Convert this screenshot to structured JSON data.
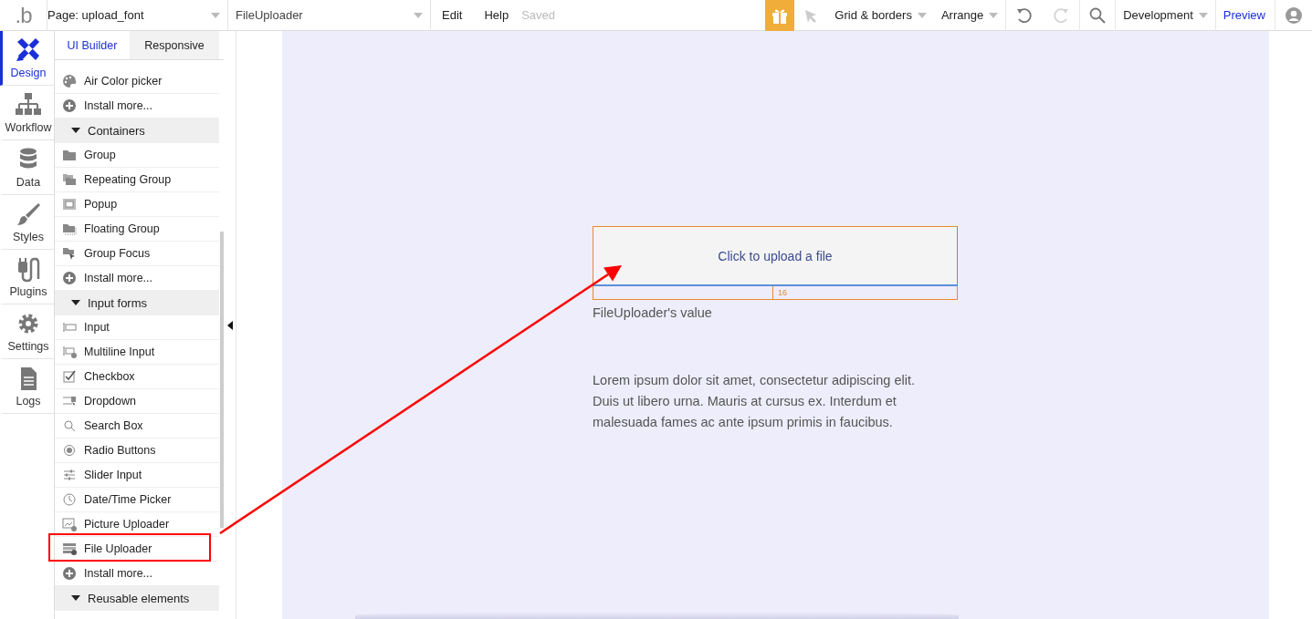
{
  "topbar": {
    "logo": ".b",
    "page_selector": "Page: upload_font",
    "element_selector": "FileUploader",
    "menu": [
      "Edit",
      "Help"
    ],
    "save_status": "Saved",
    "tools": [
      {
        "kind": "gift"
      },
      {
        "kind": "pointer",
        "disabled": true
      },
      {
        "kind": "dropdown",
        "label": "Grid & borders"
      },
      {
        "kind": "dropdown",
        "label": "Arrange"
      },
      {
        "kind": "undo",
        "disabled": false
      },
      {
        "kind": "redo",
        "disabled": true
      },
      {
        "kind": "search"
      },
      {
        "kind": "dropdown",
        "label": "Development"
      },
      {
        "kind": "link",
        "label": "Preview"
      },
      {
        "kind": "account"
      }
    ]
  },
  "nav": [
    {
      "label": "Design",
      "selected": true
    },
    {
      "label": "Workflow",
      "selected": false
    },
    {
      "label": "Data",
      "selected": false
    },
    {
      "label": "Styles",
      "selected": false
    },
    {
      "label": "Plugins",
      "selected": false
    },
    {
      "label": "Settings",
      "selected": false
    },
    {
      "label": "Logs",
      "selected": false
    }
  ],
  "panel": {
    "tabs": [
      {
        "label": "UI Builder",
        "selected": true
      },
      {
        "label": "Responsive",
        "selected": false
      }
    ],
    "items": [
      {
        "kind": "item",
        "label": "Air Color picker",
        "highlighted": false
      },
      {
        "kind": "install",
        "label": "Install more...",
        "highlighted": false
      },
      {
        "kind": "header",
        "label": "Containers",
        "expanded": true
      },
      {
        "kind": "item",
        "label": "Group",
        "highlighted": false
      },
      {
        "kind": "item",
        "label": "Repeating Group",
        "highlighted": false
      },
      {
        "kind": "item",
        "label": "Popup",
        "highlighted": false
      },
      {
        "kind": "item",
        "label": "Floating Group",
        "highlighted": false
      },
      {
        "kind": "item",
        "label": "Group Focus",
        "highlighted": false
      },
      {
        "kind": "install",
        "label": "Install more...",
        "highlighted": false
      },
      {
        "kind": "header",
        "label": "Input forms",
        "expanded": true
      },
      {
        "kind": "item",
        "label": "Input",
        "highlighted": false
      },
      {
        "kind": "item",
        "label": "Multiline Input",
        "highlighted": false
      },
      {
        "kind": "item",
        "label": "Checkbox",
        "highlighted": false
      },
      {
        "kind": "item",
        "label": "Dropdown",
        "highlighted": false
      },
      {
        "kind": "item",
        "label": "Search Box",
        "highlighted": false
      },
      {
        "kind": "item",
        "label": "Radio Buttons",
        "highlighted": false
      },
      {
        "kind": "item",
        "label": "Slider Input",
        "highlighted": false
      },
      {
        "kind": "item",
        "label": "Date/Time Picker",
        "highlighted": false
      },
      {
        "kind": "item",
        "label": "Picture Uploader",
        "highlighted": false
      },
      {
        "kind": "item",
        "label": "File Uploader",
        "highlighted": true
      },
      {
        "kind": "install",
        "label": "Install more...",
        "highlighted": false
      },
      {
        "kind": "header",
        "label": "Reusable elements",
        "expanded": true
      }
    ]
  },
  "canvas": {
    "uploader": {
      "label": "Click to upload a file",
      "spacing_label": "16"
    },
    "value_text": "FileUploader's value",
    "paragraph": "Lorem ipsum dolor sit amet, consectetur adipiscing elit. Duis ut libero urna. Mauris at cursus ex. Interdum et malesuada fames ac ante ipsum primis in faucibus."
  }
}
